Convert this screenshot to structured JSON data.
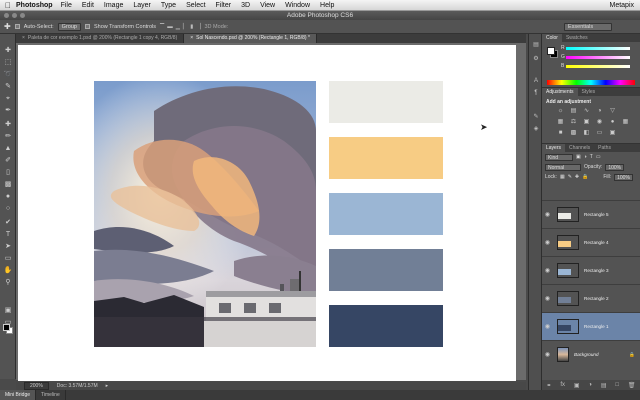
{
  "menubar": {
    "apple": "",
    "app_name": "Photoshop",
    "items": [
      "File",
      "Edit",
      "Image",
      "Layer",
      "Type",
      "Select",
      "Filter",
      "3D",
      "View",
      "Window",
      "Help"
    ],
    "right": "Metapix"
  },
  "window_title": "Adobe Photoshop CS6",
  "options": {
    "auto_select_label": "Auto-Select:",
    "auto_select_value": "Group",
    "transform_label": "Show Transform Controls",
    "mode_3d": "3D Mode:",
    "workspace": "Essentials"
  },
  "tabs": [
    {
      "label": "Paleta de cor exemplo 1.psd @ 200% (Rectangle 1 copy 4, RGB/8)",
      "active": false
    },
    {
      "label": "Sol Nascendo.psd @ 200% (Rectangle 1, RGB/8) *",
      "active": true
    }
  ],
  "canvas": {
    "swatches": [
      "#ebebe6",
      "#f7cc84",
      "#9bb6d4",
      "#717f96",
      "#364664"
    ]
  },
  "status": {
    "zoom": "200%",
    "doc": "Doc: 3.57M/1.57M"
  },
  "bottom_tabs": [
    "Mini Bridge",
    "Timeline"
  ],
  "panels": {
    "color_tabs": [
      "Color",
      "Swatches"
    ],
    "color": {
      "r_label": "R",
      "g_label": "G",
      "b_label": "B",
      "r": "255",
      "g": "255",
      "b": "255"
    },
    "adj_tabs": [
      "Adjustments",
      "Styles"
    ],
    "adj_title": "Add an adjustment",
    "layer_tabs": [
      "Layers",
      "Channels",
      "Paths"
    ],
    "kind": "Kind",
    "blend_mode": "Normal",
    "opacity_label": "Opacity:",
    "opacity": "100%",
    "lock_label": "Lock:",
    "fill_label": "Fill:",
    "fill": "100%",
    "layers": [
      {
        "name": "Rectangle 5",
        "color": "#ebebe6",
        "selected": false
      },
      {
        "name": "Rectangle 4",
        "color": "#f7cc84",
        "selected": false
      },
      {
        "name": "Rectangle 3",
        "color": "#9bb6d4",
        "selected": false
      },
      {
        "name": "Rectangle 2",
        "color": "#717f96",
        "selected": false
      },
      {
        "name": "Rectangle 1",
        "color": "#364664",
        "selected": true
      },
      {
        "name": "Background",
        "color": "#9aa6bd",
        "selected": false
      }
    ]
  }
}
